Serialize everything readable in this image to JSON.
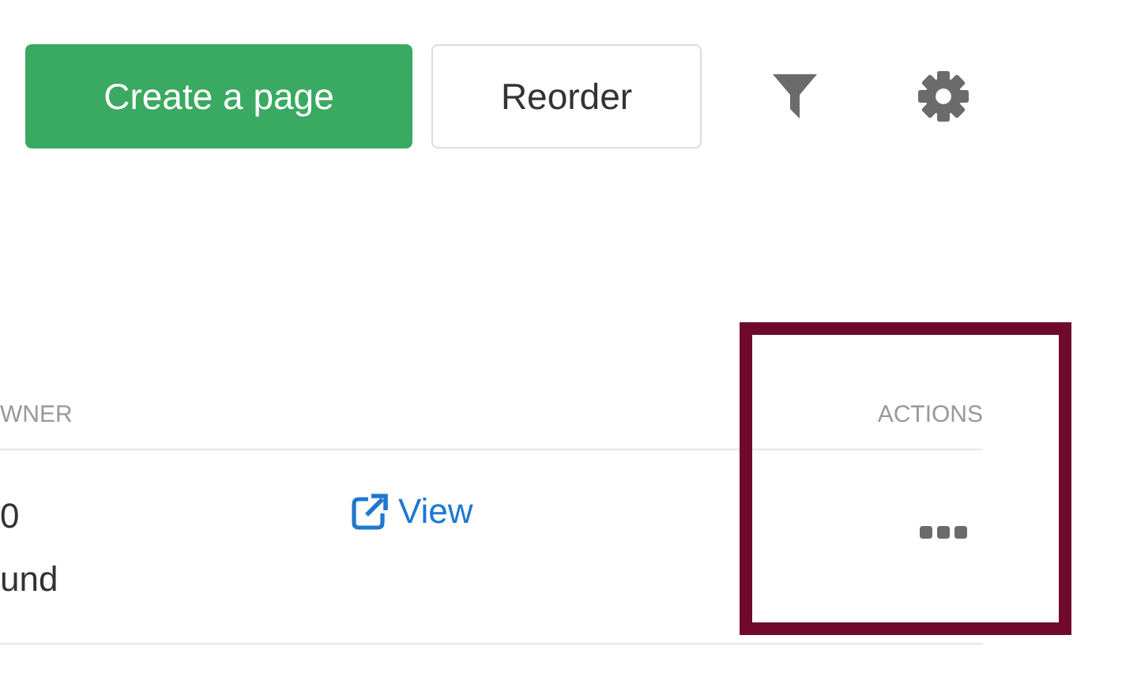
{
  "toolbar": {
    "primary_button": "Create a page",
    "secondary_button": "Reorder",
    "icons": [
      {
        "kind": "filter"
      },
      {
        "kind": "settings"
      }
    ]
  },
  "table": {
    "columns": [
      {
        "label": "WNER",
        "highlighted": false
      },
      {
        "label": "ACTIONS",
        "highlighted": true
      }
    ],
    "rows": [
      {
        "column_1": [
          "0",
          "und"
        ],
        "link": "View"
      }
    ]
  }
}
